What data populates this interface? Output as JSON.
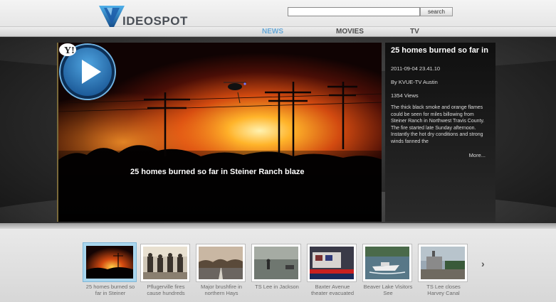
{
  "brand": {
    "logo_text": "IDEOSPOT"
  },
  "search": {
    "placeholder": "",
    "button_label": "search"
  },
  "nav": {
    "news": "NEWS",
    "movies": "MOVIES",
    "tv": "TV"
  },
  "video": {
    "title": "25 homes burned so far in Steiner Ranch blaze",
    "badge": "Y!"
  },
  "info": {
    "title": "25 homes burned so far in",
    "date": "2011-09-04 23.41.10",
    "source": "By KVUE-TV Austin",
    "views": "1354 Views",
    "description": "The thick black smoke and orange flames could be seen for miles billowing from Steiner Ranch in Northwest Travis County. The fire started late Sunday afternoon. Instantly the hot dry conditions and strong winds fanned the",
    "more_label": "More..."
  },
  "thumbnails": [
    {
      "label": "25 homes burned so far in Steiner"
    },
    {
      "label": "Pflugerville fires cause hundreds"
    },
    {
      "label": "Major brushfire in northern Hays"
    },
    {
      "label": "TS Lee in Jackson"
    },
    {
      "label": "Baxter Avenue theater evacuated"
    },
    {
      "label": "Beaver Lake Visitors See"
    },
    {
      "label": "TS Lee closes Harvey Canal"
    }
  ],
  "colors": {
    "accent": "#66a7d6",
    "play": "#2f7fc0"
  }
}
